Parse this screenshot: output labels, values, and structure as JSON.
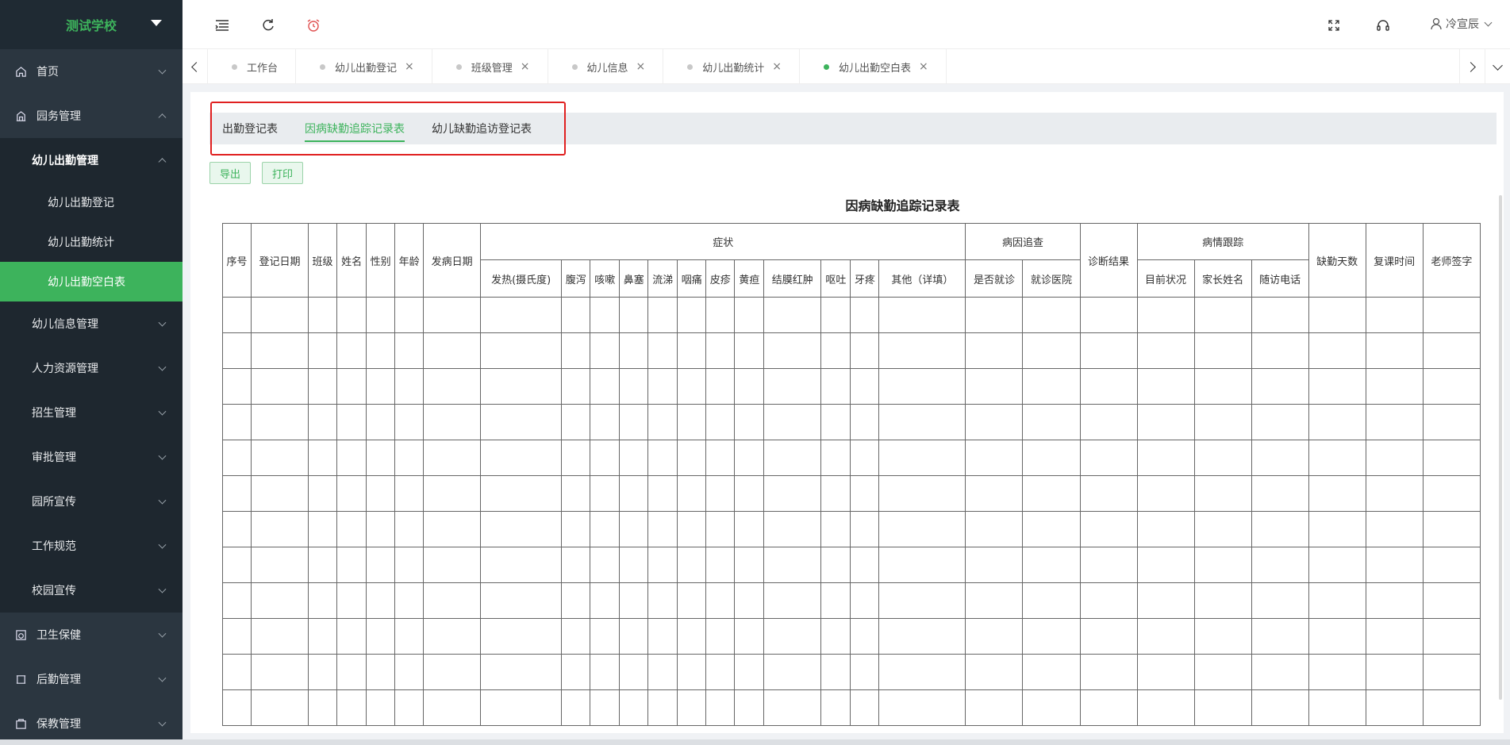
{
  "sidebar": {
    "school": "测试学校",
    "items": [
      {
        "label": "首页",
        "icon": "home-icon"
      },
      {
        "label": "园务管理",
        "icon": "building-icon"
      },
      {
        "label": "幼儿出勤管理"
      },
      {
        "label": "幼儿出勤登记"
      },
      {
        "label": "幼儿出勤统计"
      },
      {
        "label": "幼儿出勤空白表"
      },
      {
        "label": "幼儿信息管理"
      },
      {
        "label": "人力资源管理"
      },
      {
        "label": "招生管理"
      },
      {
        "label": "审批管理"
      },
      {
        "label": "园所宣传"
      },
      {
        "label": "工作规范"
      },
      {
        "label": "校园宣传"
      },
      {
        "label": "卫生保健",
        "icon": "health-icon"
      },
      {
        "label": "后勤管理",
        "icon": "logistics-icon"
      },
      {
        "label": "保教管理",
        "icon": "teaching-icon"
      }
    ]
  },
  "topbar": {
    "user": "冷宣辰",
    "icons": [
      "menu-fold-icon",
      "refresh-icon",
      "alarm-icon",
      "fullscreen-icon",
      "headset-icon",
      "user-icon"
    ]
  },
  "tags": [
    {
      "label": "工作台",
      "closable": false
    },
    {
      "label": "幼儿出勤登记",
      "closable": true
    },
    {
      "label": "班级管理",
      "closable": true
    },
    {
      "label": "幼儿信息",
      "closable": true
    },
    {
      "label": "幼儿出勤统计",
      "closable": true
    },
    {
      "label": "幼儿出勤空白表",
      "closable": true,
      "active": true
    }
  ],
  "subtabs": [
    "出勤登记表",
    "因病缺勤追踪记录表",
    "幼儿缺勤追访登记表"
  ],
  "buttons": {
    "export": "导出",
    "print": "打印"
  },
  "table": {
    "title": "因病缺勤追踪记录表",
    "headers": {
      "seq": "序号",
      "reg_date": "登记日期",
      "class": "班级",
      "name": "姓名",
      "gender": "性别",
      "age": "年龄",
      "onset": "发病日期",
      "symptoms": "症状",
      "symptom_cols": [
        "发热(摄氏度)",
        "腹泻",
        "咳嗽",
        "鼻塞",
        "流涕",
        "咽痛",
        "皮疹",
        "黄疸",
        "结膜红肿",
        "呕吐",
        "牙疼",
        "其他（详填）"
      ],
      "cause": "病因追查",
      "cause_cols": [
        "是否就诊",
        "就诊医院"
      ],
      "diagnosis": "诊断结果",
      "tracking": "病情跟踪",
      "tracking_cols": [
        "目前状况",
        "家长姓名",
        "随访电话"
      ],
      "absent_days": "缺勤天数",
      "return_time": "复课时间",
      "teacher_sign": "老师签字"
    },
    "empty_rows": 12
  },
  "colors": {
    "accent": "#3db35c",
    "sidebar_bg": "#2b3640",
    "highlight": "#e02020"
  }
}
